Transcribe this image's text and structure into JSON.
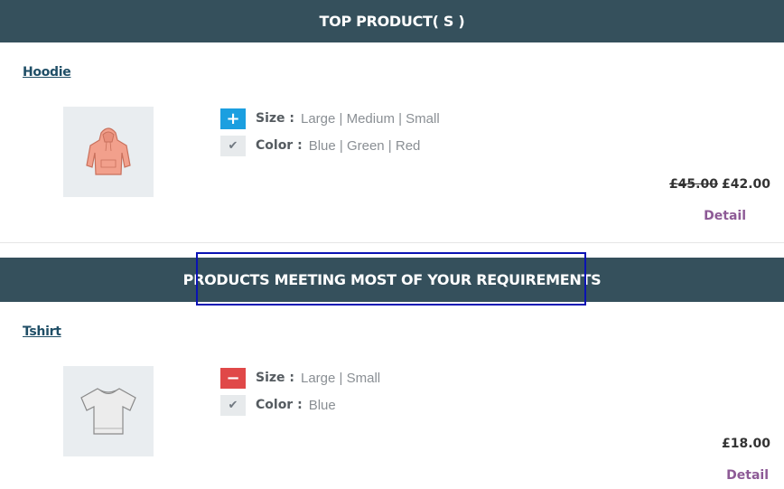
{
  "sections": {
    "top": {
      "title": "TOP PRODUCT( S )"
    },
    "meeting": {
      "title": "PRODUCTS MEETING MOST OF YOUR REQUIREMENTS"
    }
  },
  "products": [
    {
      "name": "Hoodie",
      "image_icon": "hoodie-icon",
      "match_badge": "plus",
      "attributes": [
        {
          "label": "Size :",
          "values": "Large | Medium | Small",
          "badge": "+"
        },
        {
          "label": "Color :",
          "values": "Blue | Green | Red",
          "badge": "✔"
        }
      ],
      "old_price": "£45.00",
      "price": "£42.00",
      "detail_label": "Detail"
    },
    {
      "name": "Tshirt",
      "image_icon": "tshirt-icon",
      "match_badge": "minus",
      "attributes": [
        {
          "label": "Size :",
          "values": "Large | Small",
          "badge": "−"
        },
        {
          "label": "Color :",
          "values": "Blue",
          "badge": "✔"
        }
      ],
      "price": "£18.00",
      "detail_label": "Detail"
    }
  ],
  "colors": {
    "header_bg": "#35505c",
    "plus_badge": "#1b9fe0",
    "minus_badge": "#e04848",
    "detail_link": "#8d5a96",
    "product_link": "#1f4e66"
  }
}
